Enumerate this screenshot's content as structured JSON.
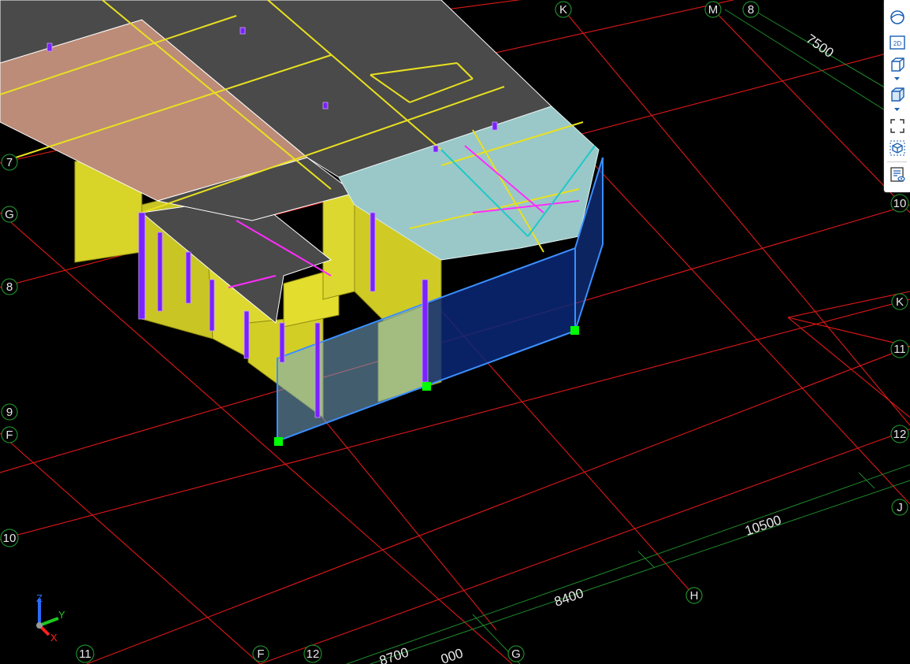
{
  "grid_bubbles": {
    "top_K": "K",
    "top_M": "M",
    "top_8": "8",
    "left_7": "7",
    "left_G": "G",
    "left_8": "8",
    "left_9": "9",
    "left_F": "F",
    "left_10": "10",
    "bottom_11": "11",
    "bottom_F": "F",
    "bottom_12": "12",
    "bottom_G": "G",
    "right_10": "10",
    "right_K": "K",
    "right_11": "11",
    "right_12": "12",
    "right_J": "J",
    "mid_H": "H"
  },
  "dimensions": {
    "d7500": "7500",
    "d10500": "10500",
    "d8400": "8400",
    "d8700": "8700",
    "d_partial": "000"
  },
  "axis_triad": {
    "z": "Z",
    "y": "Y",
    "x": "X"
  },
  "toolbar": {
    "items": [
      {
        "name": "perspective-view-button",
        "icon": "sphere-icon"
      },
      {
        "name": "2d-view-button",
        "icon": "2d-icon",
        "label": "2D"
      },
      {
        "name": "3d-view-button",
        "icon": "cube-icon"
      },
      {
        "name": "render-mode-button",
        "icon": "solid-cube-icon"
      },
      {
        "name": "zoom-extents-button",
        "icon": "frame-corners-icon"
      },
      {
        "name": "model-box-button",
        "icon": "hex-box-icon"
      },
      {
        "name": "properties-list-button",
        "icon": "list-eye-icon"
      }
    ]
  },
  "colors": {
    "background": "#000000",
    "grid_red": "#ff1a1a",
    "grid_green": "#1e8a2a",
    "wall_yellow": "#e3de2e",
    "slab_gray": "#4a4a4a",
    "slab_tan": "#bc8c78",
    "glass_teal": "#9ac8c8",
    "selection_blue": "#3b8fff",
    "column_purple": "#8a2cff",
    "grip_green": "#00ff00"
  }
}
